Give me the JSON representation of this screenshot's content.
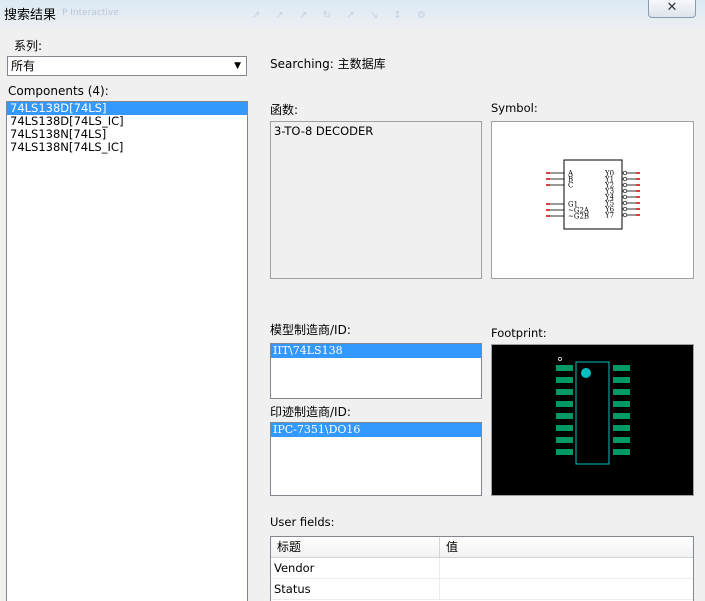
{
  "window": {
    "title": "搜索结果",
    "ghost_title": "P Interactive",
    "ghost_toolbar": "↗ ↗ ↗ ↻ ↗ ↘ ↕ ⚙",
    "close_icon": "close-icon"
  },
  "left": {
    "series_label": "系列:",
    "series_value": "所有",
    "components_label": "Components (4):",
    "components": [
      {
        "label": "74LS138D[74LS]",
        "selected": true
      },
      {
        "label": "74LS138D[74LS_IC]",
        "selected": false
      },
      {
        "label": "74LS138N[74LS]",
        "selected": false
      },
      {
        "label": "74LS138N[74LS_IC]",
        "selected": false
      }
    ]
  },
  "right": {
    "searching": "Searching: 主数据库",
    "function_label": "函数:",
    "function_value": "3-TO-8 DECODER",
    "symbol_label": "Symbol:",
    "symbol": {
      "left_pins": [
        "A",
        "B",
        "C",
        "G1",
        "~G2A",
        "~G2B"
      ],
      "right_pins": [
        "Y0",
        "Y1",
        "Y2",
        "Y3",
        "Y4",
        "Y5",
        "Y6",
        "Y7"
      ]
    },
    "model_label": "模型制造商/ID:",
    "model_items": [
      "IIT\\74LS138"
    ],
    "footprint_label": "Footprint:",
    "print_label": "印迹制造商/ID:",
    "print_items": [
      "IPC-7351\\DO16"
    ],
    "userfields_label": "User fields:",
    "userfields_headers": [
      "标题",
      "值"
    ],
    "userfields_rows": [
      {
        "title": "Vendor",
        "value": ""
      },
      {
        "title": "Status",
        "value": ""
      }
    ]
  },
  "colors": {
    "selection": "#3399ff",
    "footprint_pad": "#009966",
    "footprint_outline": "#00c0c0",
    "symbol_pin_red": "#cc0000"
  }
}
